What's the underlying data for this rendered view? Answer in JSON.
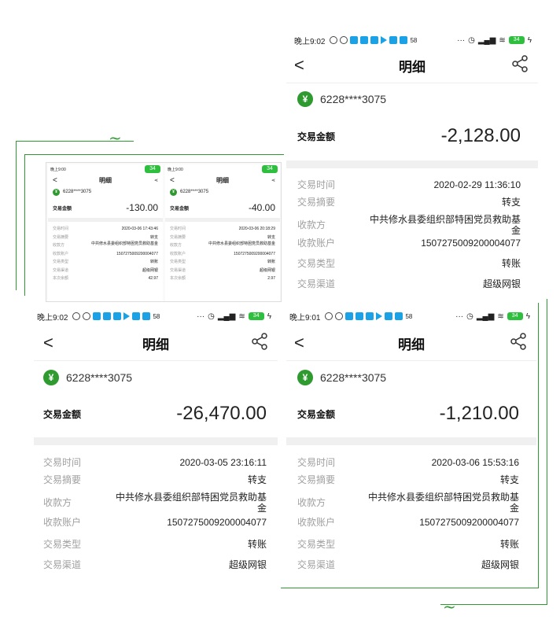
{
  "status_bar": {
    "tr_time": "晚上9:02",
    "bl_time": "晚上9:02",
    "br_time": "晚上9:01",
    "battery": "34",
    "badge": "58",
    "dots": "···"
  },
  "common": {
    "back_glyph": "<",
    "title": "明细",
    "card_number": "6228****3075",
    "amount_label": "交易金额",
    "labels": {
      "time": "交易时间",
      "summary": "交易摘要",
      "payee": "收款方",
      "account": "收款账户",
      "type": "交易类型",
      "channel": "交易渠道",
      "balance": "本次余额"
    },
    "values": {
      "summary": "转支",
      "payee": "中共修水县委组织部特困党员救助基金",
      "account": "1507275009200004077",
      "type": "转账",
      "channel": "超级网银"
    }
  },
  "screens": {
    "top_right": {
      "amount": "-2,128.00",
      "time": "2020-02-29 11:36:10"
    },
    "bottom_left": {
      "amount": "-26,470.00",
      "time": "2020-03-05 23:16:11"
    },
    "bottom_right": {
      "amount": "-1,210.00",
      "time": "2020-03-06 15:53:16"
    },
    "thumb1": {
      "status_time": "晚上9:00",
      "amount": "-130.00",
      "time": "2020-03-06 17:43:46",
      "type": "转账",
      "balance": "42.97"
    },
    "thumb2": {
      "status_time": "晚上9:00",
      "amount": "-40.00",
      "time": "2020-03-06 20:18:29",
      "type": "转账",
      "balance": "2.97"
    }
  },
  "colors": {
    "accent": "#2f9a2f",
    "muted": "#a0a0a0"
  }
}
